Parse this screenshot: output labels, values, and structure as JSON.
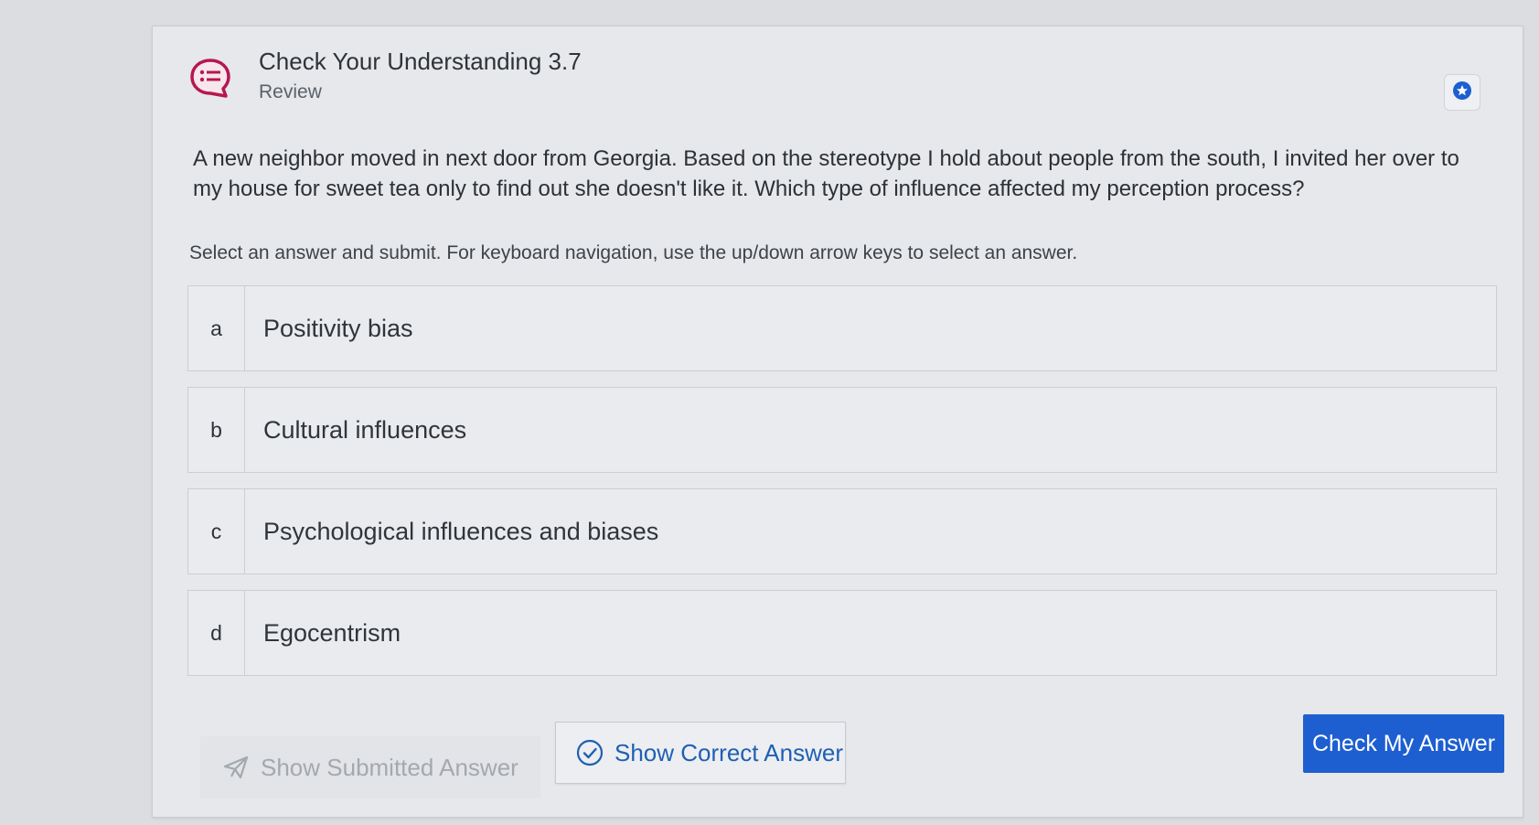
{
  "header": {
    "title": "Check Your Understanding 3.7",
    "subtitle": "Review",
    "icon": "quiz-chat-icon",
    "accent_color": "#b5174f"
  },
  "bookmark": {
    "icon": "bookmark-star-icon",
    "color": "#1d5fd1"
  },
  "question": {
    "text": "A new neighbor moved in next door from Georgia. Based on the stereotype I hold about people from the south, I invited her over to my house for sweet tea only to find out she doesn't like it. Which type of influence affected my perception process?"
  },
  "instructions": "Select an answer and submit. For keyboard navigation, use the up/down arrow keys to select an answer.",
  "answers": [
    {
      "letter": "a",
      "text": "Positivity bias"
    },
    {
      "letter": "b",
      "text": "Cultural influences"
    },
    {
      "letter": "c",
      "text": "Psychological influences and biases"
    },
    {
      "letter": "d",
      "text": "Egocentrism"
    }
  ],
  "footer": {
    "show_submitted_label": "Show Submitted Answer",
    "show_correct_label": "Show Correct Answer",
    "check_label": "Check My Answer",
    "check_color": "#1d5fd1"
  }
}
